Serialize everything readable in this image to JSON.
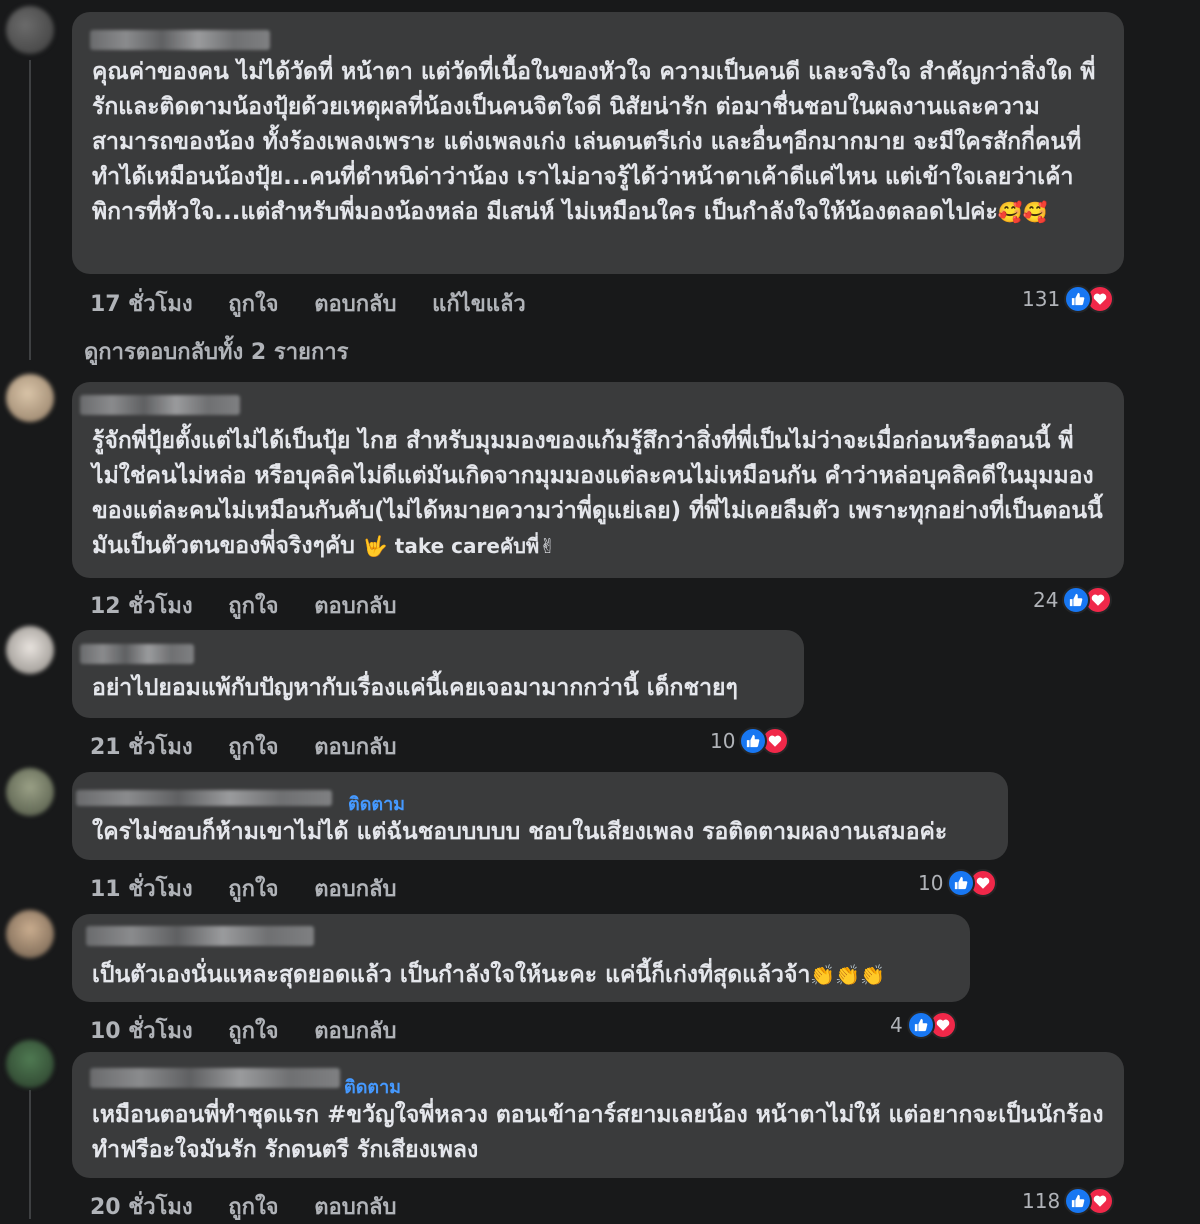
{
  "comments": [
    {
      "text": "คุณค่าของคน ไม่ได้วัดที่ หน้าตา แต่วัดที่เนื้อในของหัวใจ ความเป็นคนดี และจริงใจ สำคัญกว่าสิ่งใด พี่รักและติดตามน้องปุ้ยด้วยเหตุผลที่น้องเป็นคนจิตใจดี นิสัยน่ารัก ต่อมาชื่นชอบในผลงานและความสามารถของน้อง ทั้งร้องเพลงเพราะ แต่งเพลงเก่ง เล่นดนตรีเก่ง และอื่นๆอีกมากมาย จะมีใครสักกี่คนที่ทำได้เหมือนน้องปุ้ย...คนที่ตำหนิด่าว่าน้อง เราไม่อาจรู้ได้ว่าหน้าตาเค้าดีแค่ไหน แต่เข้าใจเลยว่าเค้าพิการที่หัวใจ...แต่สำหรับพี่มองน้องหล่อ มีเสน่ห์ ไม่เหมือนใคร เป็นกำลังใจให้น้องตลอดไปค่ะ",
      "emojis": "🥰🥰",
      "time": "17 ชั่วโมง",
      "like": "ถูกใจ",
      "reply": "ตอบกลับ",
      "edited": "แก้ไขแล้ว",
      "reactions": "131"
    },
    {
      "text": "รู้จักพี่ปุ้ยตั้งแต่ไม่ได้เป็นปุ้ย ไกฮ สำหรับมุมมองของแก้มรู้สึกว่าสิ่งที่พี่เป็นไม่ว่าจะเมื่อก่อนหรือตอนนี้ พี่ไม่ใช่คนไม่หล่อ หรือบุคลิคไม่ดีแต่มันเกิดจากมุมมองแต่ละคนไม่เหมือนกัน คำว่าหล่อบุคลิคดีในมุมมองของแต่ละคนไม่เหมือนกันคับ(ไม่ได้หมายความว่าพี่ดูแย่เลย) ที่พี่ไม่เคยลืมตัว เพราะทุกอย่างที่เป็นตอนนี้ มันเป็นตัวตนของพี่จริงๆคับ ",
      "emojis": "🤟 take careคับพี่✌",
      "time": "12 ชั่วโมง",
      "like": "ถูกใจ",
      "reply": "ตอบกลับ",
      "reactions": "24"
    },
    {
      "text": "อย่าไปยอมแพ้กับปัญหากับเรื่องแค่นี้เคยเจอมามากกว่านี้ เด็กชายๆ",
      "time": "21 ชั่วโมง",
      "like": "ถูกใจ",
      "reply": "ตอบกลับ",
      "reactions": "10"
    },
    {
      "follow": "ติดตาม",
      "text": "ใครไม่ชอบก็ห้ามเขาไม่ได้ แต่ฉันชอบบบบบ ชอบในเสียงเพลง รอติดตามผลงานเสมอค่ะ",
      "time": "11 ชั่วโมง",
      "like": "ถูกใจ",
      "reply": "ตอบกลับ",
      "reactions": "10"
    },
    {
      "text": "เป็นตัวเองนั่นแหละสุดยอดแล้ว เป็นกำลังใจให้นะคะ แค่นี้ก็เก่งที่สุดแล้วจ้า",
      "emojis": "👏👏👏",
      "time": "10 ชั่วโมง",
      "like": "ถูกใจ",
      "reply": "ตอบกลับ",
      "reactions": "4"
    },
    {
      "follow": "ติดตาม",
      "text": "เหมือนตอนพี่ทำชุดแรก #ขวัญใจพี่หลวง ตอนเข้าอาร์สยามเลยน้อง หน้าตาไม่ให้ แต่อยากจะเป็นนักร้อง ทำฟรีอะใจมันรัก รักดนตรี รักเสียงเพลง",
      "time": "20 ชั่วโมง",
      "like": "ถูกใจ",
      "reply": "ตอบกลับ",
      "reactions": "118"
    }
  ],
  "view_replies": "ดูการตอบกลับทั้ง 2 รายการ",
  "icons": {
    "like": "thumbs-up-icon",
    "love": "heart-icon"
  },
  "colors": {
    "background": "#18191a",
    "bubble": "#3a3b3c",
    "like": "#1877f2",
    "love": "#f02849",
    "follow": "#4599ff"
  }
}
